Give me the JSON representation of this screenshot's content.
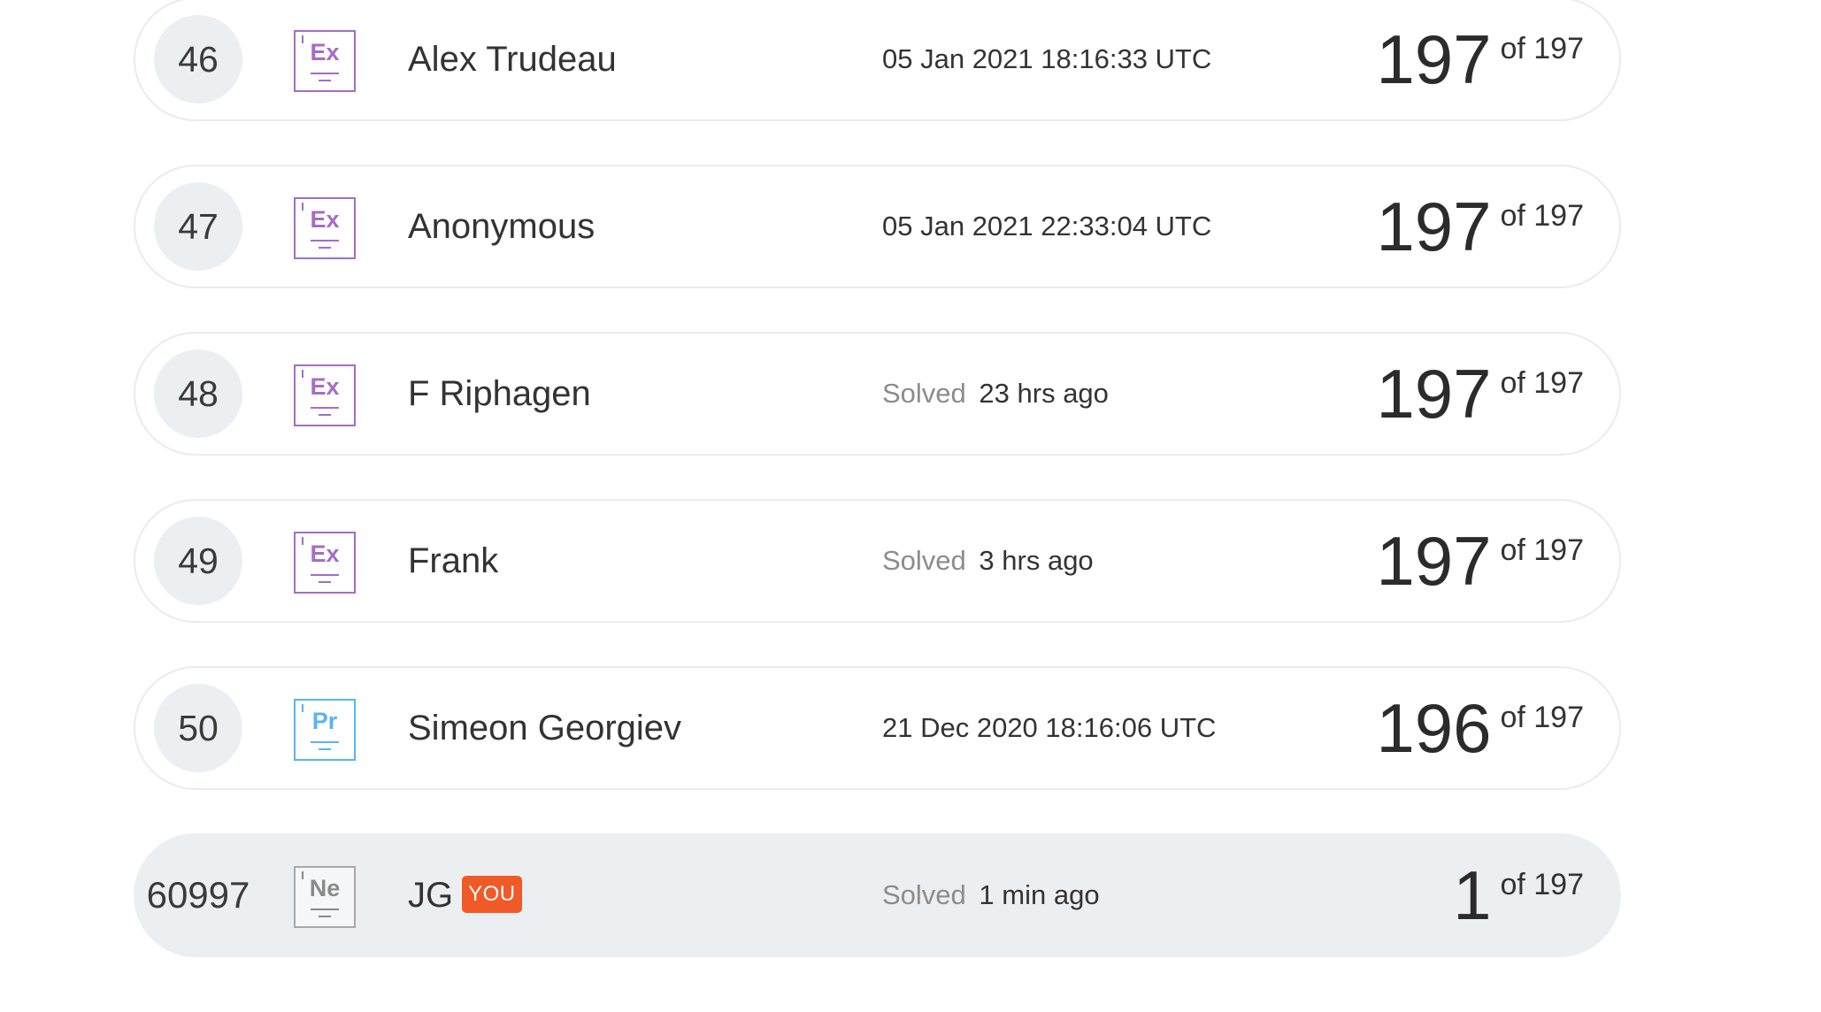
{
  "leaderboard": {
    "rows": [
      {
        "rank": "46",
        "badge": {
          "symbol": "Ex",
          "variant": "ex",
          "icon": "expert-badge-icon"
        },
        "name": "Alex Trudeau",
        "when_label": "",
        "when_value": "05 Jan 2021 18:16:33 UTC",
        "score": "197",
        "of_total": "of 197",
        "is_you": false
      },
      {
        "rank": "47",
        "badge": {
          "symbol": "Ex",
          "variant": "ex",
          "icon": "expert-badge-icon"
        },
        "name": "Anonymous",
        "when_label": "",
        "when_value": "05 Jan 2021 22:33:04 UTC",
        "score": "197",
        "of_total": "of 197",
        "is_you": false
      },
      {
        "rank": "48",
        "badge": {
          "symbol": "Ex",
          "variant": "ex",
          "icon": "expert-badge-icon"
        },
        "name": "F Riphagen",
        "when_label": "Solved",
        "when_value": "23 hrs ago",
        "score": "197",
        "of_total": "of 197",
        "is_you": false
      },
      {
        "rank": "49",
        "badge": {
          "symbol": "Ex",
          "variant": "ex",
          "icon": "expert-badge-icon"
        },
        "name": "Frank",
        "when_label": "Solved",
        "when_value": "3 hrs ago",
        "score": "197",
        "of_total": "of 197",
        "is_you": false
      },
      {
        "rank": "50",
        "badge": {
          "symbol": "Pr",
          "variant": "pr",
          "icon": "pro-badge-icon"
        },
        "name": "Simeon Georgiev",
        "when_label": "",
        "when_value": "21 Dec 2020 18:16:06 UTC",
        "score": "196",
        "of_total": "of 197",
        "is_you": false
      },
      {
        "rank": "60997",
        "badge": {
          "symbol": "Ne",
          "variant": "ne",
          "icon": "newbie-badge-icon"
        },
        "name": "JG",
        "you_tag": "YOU",
        "when_label": "Solved",
        "when_value": "1 min ago",
        "score": "1",
        "of_total": "of 197",
        "is_you": true
      }
    ]
  },
  "colors": {
    "expert": "#a46cc7",
    "pro": "#5ab4ee",
    "newbie": "#a8a8a8",
    "you_tag": "#f05a28",
    "you_row_bg": "#eceff2",
    "row_border": "#e9ebee"
  }
}
